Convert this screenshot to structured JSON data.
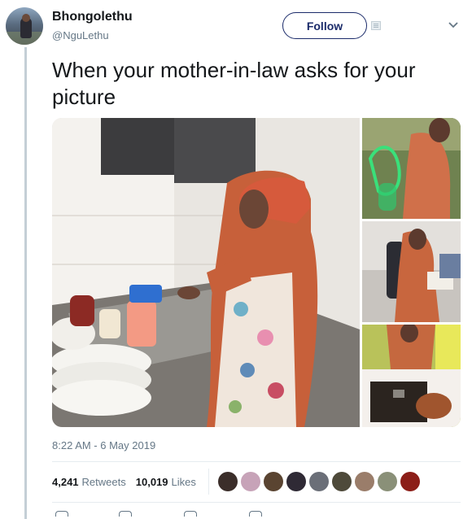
{
  "user": {
    "display_name": "Bhongolethu",
    "handle": "@NguLethu",
    "avatar_icon": "profile-photo"
  },
  "follow_button": {
    "label": "Follow",
    "color": "#1b2b6a"
  },
  "tweet": {
    "text": "When your mother-in-law asks for your picture",
    "timestamp": "8:22 AM - 6 May 2019"
  },
  "media": {
    "photos": [
      {
        "id": "main",
        "subject": "woman-washing-dishes"
      },
      {
        "id": "side1",
        "subject": "woman-with-hookah"
      },
      {
        "id": "side2",
        "subject": "woman-reading-at-desk"
      },
      {
        "id": "side3",
        "subject": "woman-on-bed"
      }
    ]
  },
  "stats": {
    "retweets_count": "4,241",
    "retweets_label": "Retweets",
    "likes_count": "10,019",
    "likes_label": "Likes"
  },
  "likers": [
    {
      "color": "#3b2e2a"
    },
    {
      "color": "#c7a3b8"
    },
    {
      "color": "#5a4431"
    },
    {
      "color": "#2f2a35"
    },
    {
      "color": "#6b6f78"
    },
    {
      "color": "#4e4a3a"
    },
    {
      "color": "#9a7d6a"
    },
    {
      "color": "#8a9078"
    },
    {
      "color": "#8c1e18"
    }
  ],
  "colors": {
    "thread_line": "#c4cfd6",
    "secondary_text": "#657786",
    "accent": "#1b2b6a"
  }
}
